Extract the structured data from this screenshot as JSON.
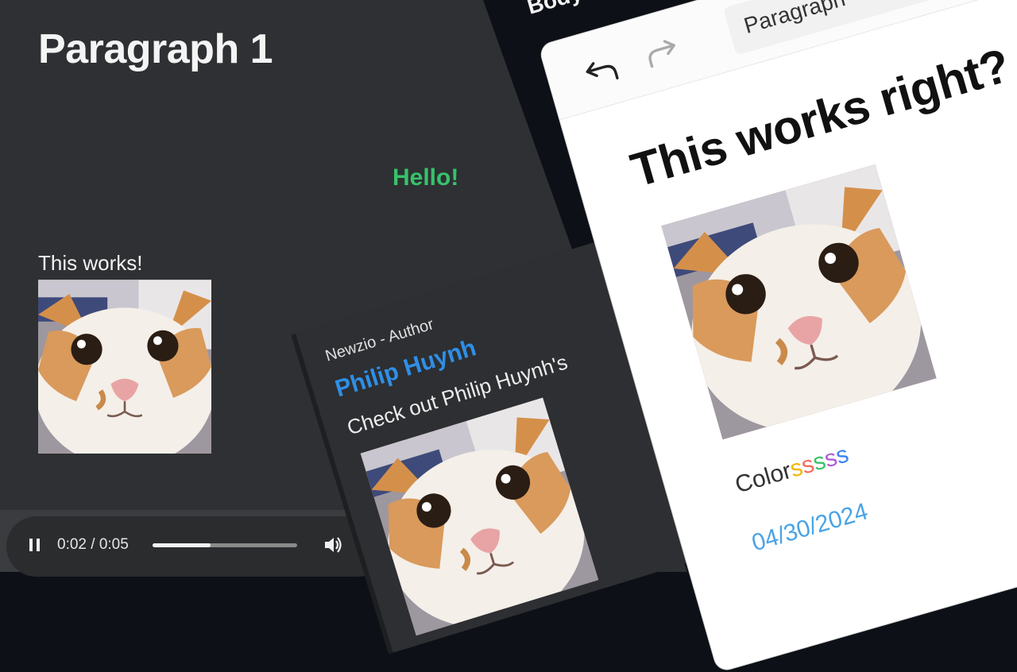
{
  "left": {
    "title": "Paragraph 1",
    "hello": "Hello!",
    "works_text": "This works!"
  },
  "audio": {
    "time": "0:02 / 0:05",
    "progress": 0.4
  },
  "author_card": {
    "role": "Newzio - Author",
    "name": "Philip Huynh",
    "description": "Check out Philip Huynh's"
  },
  "editor": {
    "header_label": "Body",
    "block_type": "Paragraph",
    "heading": "This works right?",
    "colors_text": {
      "base": "Color",
      "letters": [
        "s",
        "s",
        "s",
        "s",
        "s"
      ],
      "letter_colors": [
        "#f2b705",
        "#f26d5b",
        "#37c26a",
        "#b05bd6",
        "#3b82f6"
      ]
    },
    "date": "04/30/2024"
  },
  "colors": {
    "accent_green": "#37c26a",
    "link_blue": "#2f8fe6",
    "dark_panel": "#2e3033"
  }
}
